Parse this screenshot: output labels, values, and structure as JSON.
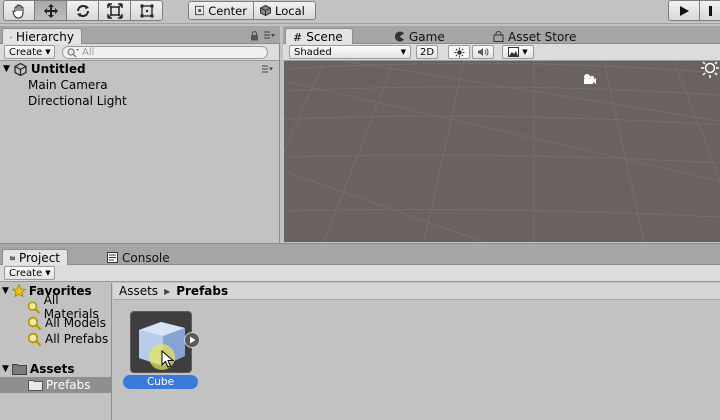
{
  "toolbar": {
    "tools": [
      "hand-tool",
      "move-tool",
      "rotate-tool",
      "scale-tool",
      "rect-tool"
    ],
    "pivot_label": "Center",
    "space_label": "Local"
  },
  "hierarchy": {
    "tab_label": "Hierarchy",
    "create_label": "Create",
    "search_placeholder": "All",
    "scene_name": "Untitled",
    "items": [
      "Main Camera",
      "Directional Light"
    ]
  },
  "scene": {
    "tabs": [
      "Scene",
      "Game",
      "Asset Store"
    ],
    "shading_label": "Shaded",
    "mode_2d_label": "2D"
  },
  "project": {
    "tabs": [
      "Project",
      "Console"
    ],
    "create_label": "Create",
    "favorites_label": "Favorites",
    "favorites": [
      "All Materials",
      "All Models",
      "All Prefabs"
    ],
    "assets_label": "Assets",
    "assets_children": [
      "Prefabs"
    ],
    "breadcrumb": [
      "Assets",
      "Prefabs"
    ],
    "asset_items": [
      {
        "name": "Cube"
      }
    ]
  },
  "colors": {
    "selection": "#3a7ad8",
    "viewport": "#6a625e",
    "panel": "#c2c2c2"
  }
}
